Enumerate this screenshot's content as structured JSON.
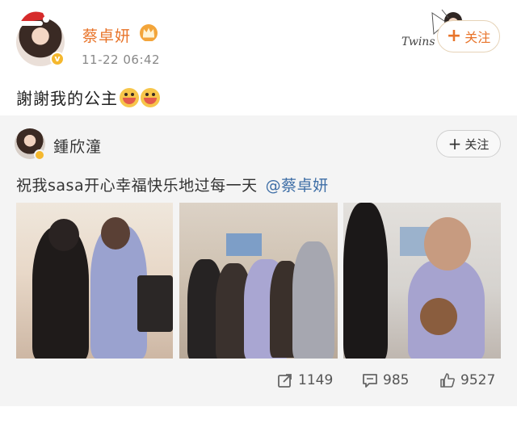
{
  "post": {
    "username": "蔡卓妍",
    "timestamp": "11-22 06:42",
    "text": "謝謝我的公主",
    "follow_label": "关注",
    "signature": "Twins"
  },
  "repost": {
    "username": "鍾欣潼",
    "follow_label": "关注",
    "text": "祝我sasa开心幸福快乐地过每一天",
    "mention": "@蔡卓妍",
    "images": [
      "photo-1",
      "photo-2",
      "photo-3"
    ],
    "stats": {
      "shares": "1149",
      "comments": "985",
      "likes": "9527"
    }
  },
  "icons": {
    "share": "share-icon",
    "comment": "comment-icon",
    "like": "like-icon",
    "crown": "crown-icon",
    "verified": "verified-badge-icon"
  },
  "colors": {
    "accent": "#e8742a",
    "mention": "#3e6ea6",
    "verified": "#f5b82e"
  }
}
